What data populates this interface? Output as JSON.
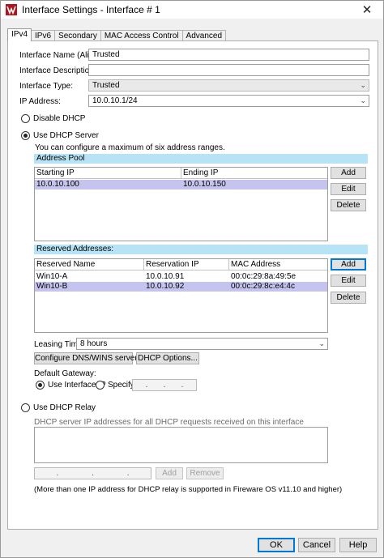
{
  "window": {
    "title": "Interface Settings - Interface # 1",
    "close_glyph": "✕"
  },
  "tabs": [
    "IPv4",
    "IPv6",
    "Secondary",
    "MAC Access Control",
    "Advanced"
  ],
  "form": {
    "name_label": "Interface Name (Alias):",
    "name_value": "Trusted",
    "description_label": "Interface Description:",
    "description_value": "",
    "type_label": "Interface Type:",
    "type_value": "Trusted",
    "ip_label": "IP Address:",
    "ip_value": "10.0.10.1/24"
  },
  "dhcp": {
    "disable_label": "Disable DHCP",
    "server_label": "Use DHCP Server",
    "server_note": "You can configure a maximum of six address ranges.",
    "relay_label": "Use DHCP Relay"
  },
  "address_pool": {
    "header": "Address Pool",
    "columns": [
      "Starting IP",
      "Ending IP"
    ],
    "rows": [
      [
        "10.0.10.100",
        "10.0.10.150"
      ]
    ],
    "add": "Add",
    "edit": "Edit",
    "delete": "Delete"
  },
  "reserved": {
    "header": "Reserved Addresses:",
    "columns": [
      "Reserved Name",
      "Reservation IP",
      "MAC Address"
    ],
    "rows": [
      [
        "Win10-A",
        "10.0.10.91",
        "00:0c:29:8a:49:5e"
      ],
      [
        "Win10-B",
        "10.0.10.92",
        "00:0c:29:8c:e4:4c"
      ]
    ],
    "add": "Add",
    "edit": "Edit",
    "delete": "Delete"
  },
  "leasing": {
    "label": "Leasing Time",
    "value": "8 hours"
  },
  "buttons": {
    "dns_wins": "Configure DNS/WINS servers",
    "dhcp_options": "DHCP Options..."
  },
  "gateway": {
    "label": "Default Gateway:",
    "use_interface": "Use Interface IP",
    "specify": "Specify",
    "dots": [
      ".",
      ".",
      "."
    ]
  },
  "relay": {
    "note": "DHCP server IP addresses for all DHCP requests received on this interface",
    "add": "Add",
    "remove": "Remove",
    "dots": [
      ".",
      ".",
      "."
    ],
    "footnote": "(More than one IP address for DHCP relay is supported in Fireware OS v11.10 and higher)"
  },
  "footer": {
    "ok": "OK",
    "cancel": "Cancel",
    "help": "Help"
  },
  "colors": {
    "section_header": "#b7e3f7",
    "selected_row": "#c4c4ee",
    "focus_border": "#0078d7"
  }
}
